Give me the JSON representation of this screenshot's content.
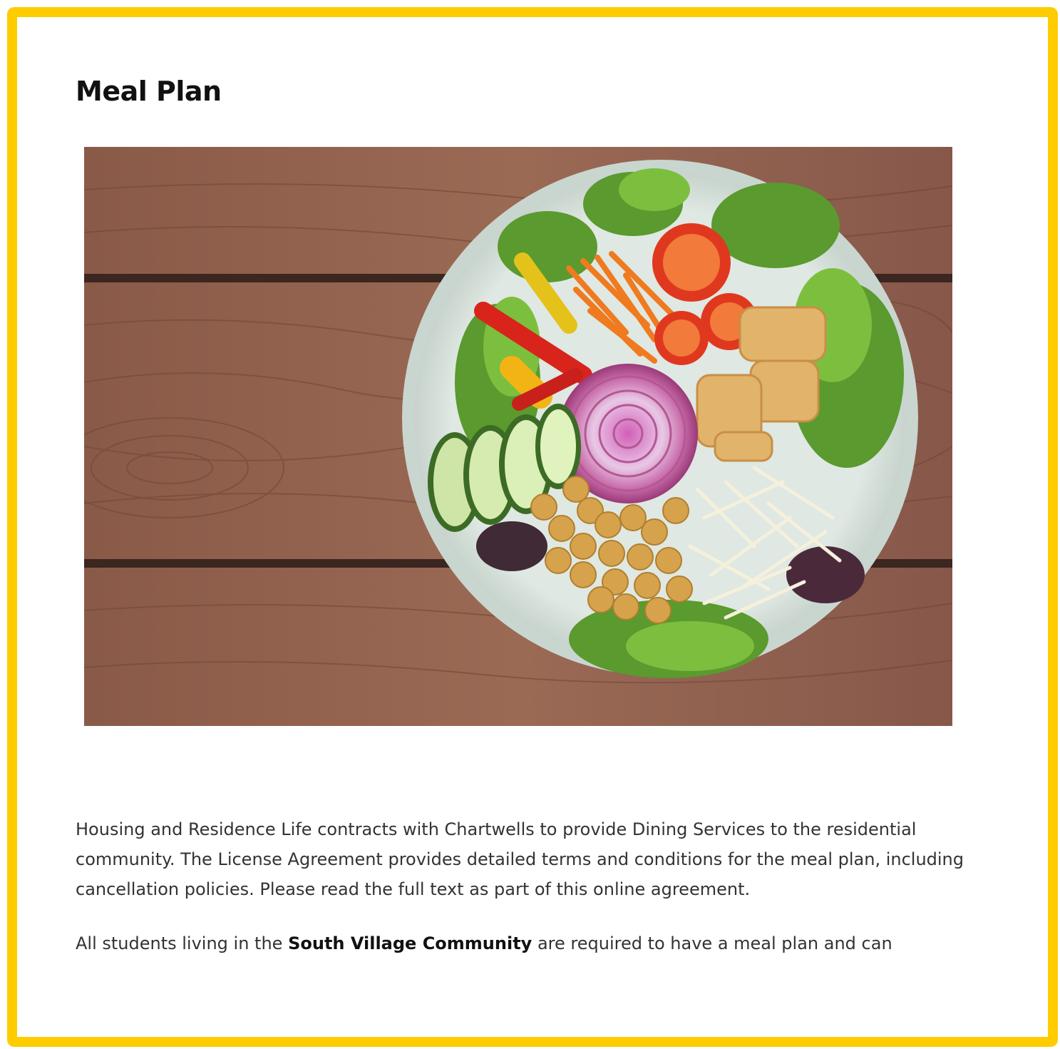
{
  "page": {
    "title": "Meal Plan",
    "accent_color": "#FFCC00"
  },
  "hero_image": {
    "icon": "salad-bowl-photo",
    "alt": ""
  },
  "intro": {
    "paragraph1": "Housing and Residence Life contracts with Chartwells to provide Dining Services to the residential community. The License Agreement provides detailed terms and conditions for the meal plan, including cancellation policies. Please read the full text as part of this online agreement.",
    "p2_before": "All students living in the ",
    "p2_bold": "South Village Community",
    "p2_after": " are required to have a meal plan and can"
  }
}
